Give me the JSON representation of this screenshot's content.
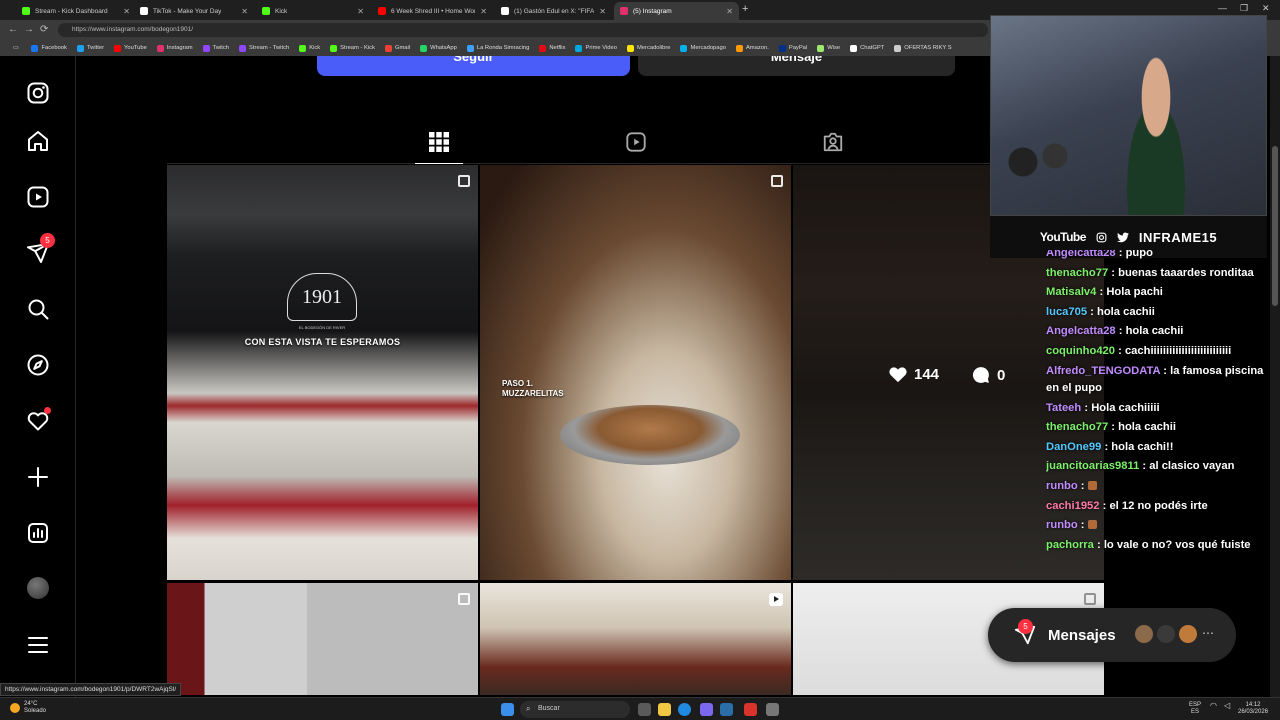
{
  "browser": {
    "tabs": [
      {
        "title": "Stream - Kick Dashboard",
        "color": "#53fc18",
        "active": false
      },
      {
        "title": "TikTok - Make Your Day",
        "color": "#ffffff",
        "active": false
      },
      {
        "title": "Kick",
        "color": "#53fc18",
        "active": false
      },
      {
        "title": "6 Week Shred III • Home Workout",
        "color": "#ff0000",
        "active": false
      },
      {
        "title": "(1) Gastón Edul en X: \"FIFA anunci",
        "color": "#ffffff",
        "active": false
      },
      {
        "title": "(5) Instagram",
        "color": "#e1306c",
        "active": true
      }
    ],
    "new_tab": "+",
    "url": "https://www.instagram.com/bodegon1901/",
    "window_controls": [
      "—",
      "❐",
      "✕"
    ],
    "bookmarks": [
      {
        "label": "Facebook",
        "color": "#1877f2"
      },
      {
        "label": "Twitter",
        "color": "#1da1f2"
      },
      {
        "label": "YouTube",
        "color": "#ff0000"
      },
      {
        "label": "Instagram",
        "color": "#e1306c"
      },
      {
        "label": "Twitch",
        "color": "#9146ff"
      },
      {
        "label": "Stream - Twitch",
        "color": "#9146ff"
      },
      {
        "label": "Kick",
        "color": "#53fc18"
      },
      {
        "label": "Stream - Kick",
        "color": "#53fc18"
      },
      {
        "label": "Gmail",
        "color": "#ea4335"
      },
      {
        "label": "WhatsApp",
        "color": "#25d366"
      },
      {
        "label": "La Ronda Simracing",
        "color": "#3ba0ff"
      },
      {
        "label": "Netflix",
        "color": "#e50914"
      },
      {
        "label": "Prime Video",
        "color": "#00a8e1"
      },
      {
        "label": "Mercadolibre",
        "color": "#ffe600"
      },
      {
        "label": "Mercadopago",
        "color": "#00b1ea"
      },
      {
        "label": "Amazon.",
        "color": "#ff9900"
      },
      {
        "label": "PayPal",
        "color": "#003087"
      },
      {
        "label": "Wise",
        "color": "#9fe870"
      },
      {
        "label": "ChatGPT",
        "color": "#ffffff"
      },
      {
        "label": "OFERTAS RIKY S",
        "color": "#cccccc"
      }
    ]
  },
  "instagram": {
    "sidebar": {
      "notifications_count": "5"
    },
    "profile": {
      "follow_label": "Seguir",
      "message_label": "Mensaje"
    },
    "posts": [
      {
        "text_main": "CON ESTA VISTA TE ESPERAMOS",
        "logo": "1901",
        "logo_sub": "EL BODEGÓN DE RIVER",
        "type": "carousel"
      },
      {
        "text_main": "PASO 1.\nMUZZARELITAS",
        "type": "carousel"
      },
      {
        "likes": "144",
        "comments": "0",
        "type": "photo"
      },
      {
        "type": "carousel"
      },
      {
        "type": "reel"
      },
      {
        "type": "carousel"
      }
    ],
    "messages_pill": {
      "label": "Mensajes",
      "count": "5"
    },
    "status_url": "https://www.instagram.com/bodegon1901/p/DWRT2wAjqSl/"
  },
  "stream_overlay": {
    "social_platform": "YouTube",
    "handle": "INFRAME15",
    "chat": [
      {
        "user": "Angelcatta28",
        "color": "#c08cff",
        "text": "pupo"
      },
      {
        "user": "thenacho77",
        "color": "#7cf06a",
        "text": "buenas taaardes ronditaa"
      },
      {
        "user": "Matisalv4",
        "color": "#7cf06a",
        "text": "Hola pachi"
      },
      {
        "user": "luca705",
        "color": "#52c8ff",
        "text": "hola cachii"
      },
      {
        "user": "Angelcatta28",
        "color": "#c08cff",
        "text": "hola cachii"
      },
      {
        "user": "coquinho420",
        "color": "#7cf06a",
        "text": "cachiiiiiiiiiiiiiiiiiiiiiiiiii"
      },
      {
        "user": "Alfredo_TENGODATA",
        "color": "#c08cff",
        "text": "la famosa piscina en el pupo",
        "wrap": true
      },
      {
        "user": "Tateeh",
        "color": "#c08cff",
        "text": "Hola cachiiiii"
      },
      {
        "user": "thenacho77",
        "color": "#7cf06a",
        "text": "hola cachii"
      },
      {
        "user": "DanOne99",
        "color": "#52c8ff",
        "text": "hola cachi!!"
      },
      {
        "user": "juancitoarias9811",
        "color": "#7cf06a",
        "text": "al clasico vayan"
      },
      {
        "user": "runbo",
        "color": "#c08cff",
        "text": ""
      },
      {
        "user": "cachi1952",
        "color": "#ff7aa8",
        "text": "el 12 no podés irte"
      },
      {
        "user": "runbo",
        "color": "#c08cff",
        "text": ""
      },
      {
        "user": "pachorra",
        "color": "#7cf06a",
        "text": "lo vale o no? vos qué fuiste"
      }
    ]
  },
  "taskbar": {
    "weather_temp": "24°C",
    "weather_desc": "Soleado",
    "search_placeholder": "Buscar",
    "lang_top": "ESP",
    "lang_bottom": "ES",
    "time": "14:12",
    "date": "26/03/2026"
  }
}
